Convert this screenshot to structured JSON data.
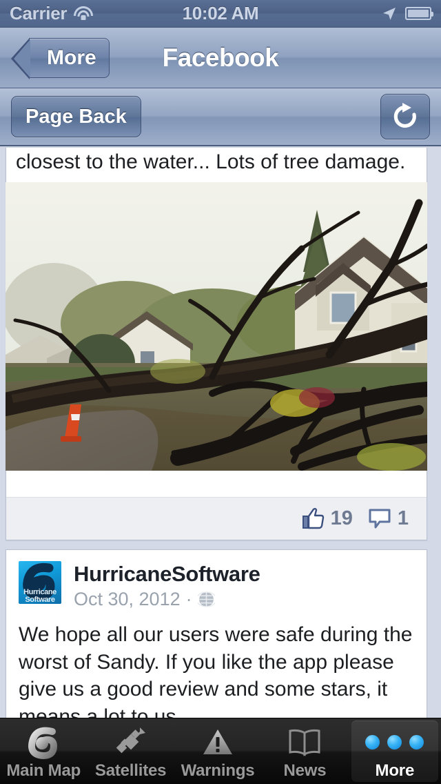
{
  "status_bar": {
    "carrier": "Carrier",
    "time": "10:02 AM",
    "wifi_icon": "wifi-icon",
    "location_icon": "location-arrow-icon",
    "battery_icon": "battery-icon"
  },
  "nav_bar": {
    "back_label": "More",
    "title": "Facebook"
  },
  "toolbar": {
    "page_back_label": "Page Back",
    "refresh_icon": "refresh-icon"
  },
  "feed": {
    "post_1": {
      "text_fragment": "closest to the water... Lots of tree damage.",
      "photo_alt": "fallen-tree-storm-damage-photo",
      "like_icon": "thumbs-up-icon",
      "like_count": "19",
      "comment_icon": "comment-bubble-icon",
      "comment_count": "1"
    },
    "post_2": {
      "avatar_label_line1": "Hurricane",
      "avatar_label_line2": "Software",
      "author": "HurricaneSoftware",
      "date": "Oct 30, 2012",
      "meta_separator": "·",
      "privacy_icon": "globe-icon",
      "body": "We hope all our users were safe during the worst of Sandy. If you like the app please give us a good review and some stars, it means a lot to us."
    }
  },
  "tab_bar": {
    "tabs": [
      {
        "label": "Main Map",
        "icon": "hurricane-swirl-icon",
        "selected": false
      },
      {
        "label": "Satellites",
        "icon": "satellite-icon",
        "selected": false
      },
      {
        "label": "Warnings",
        "icon": "warning-triangle-icon",
        "selected": false
      },
      {
        "label": "News",
        "icon": "open-book-icon",
        "selected": false
      },
      {
        "label": "More",
        "icon": "three-dots-icon",
        "selected": true
      }
    ]
  },
  "colors": {
    "nav_blue": "#7e93b4",
    "status_blue": "#4d6186",
    "page_bg": "#d3d9e6",
    "facebook_blue": "#3b5998",
    "tab_accent": "#36b2f5"
  }
}
